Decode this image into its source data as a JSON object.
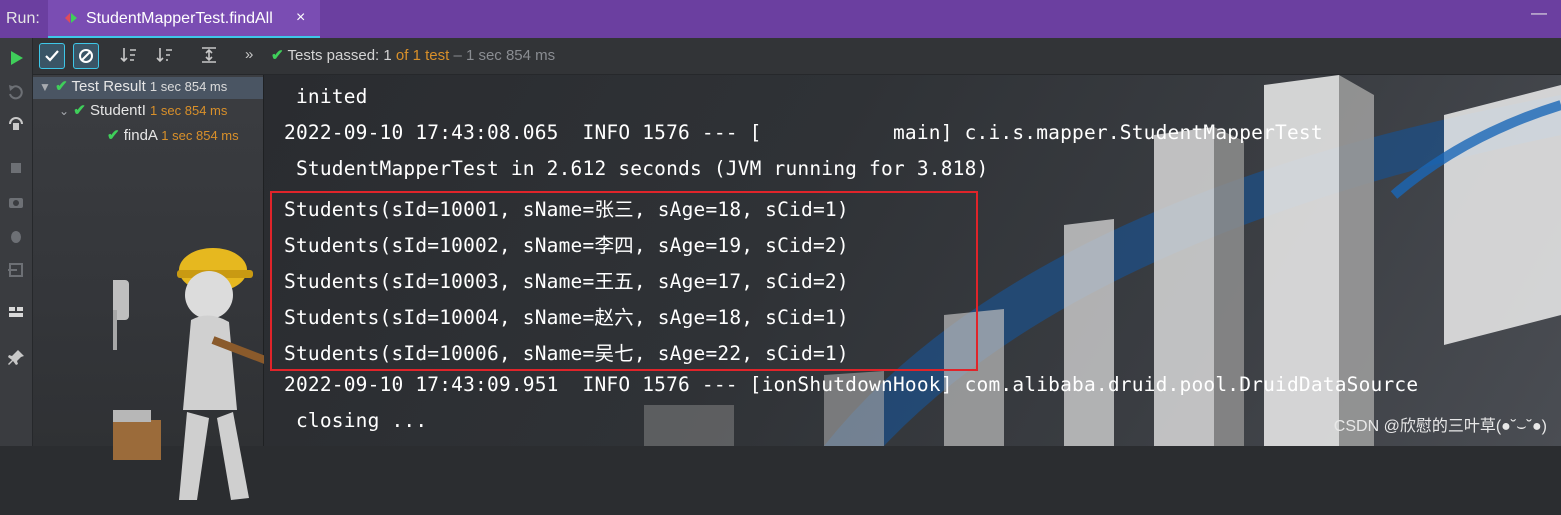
{
  "runbar": {
    "label": "Run:",
    "tab_title": "StudentMapperTest.findAll",
    "close": "×",
    "minimize": "—"
  },
  "toolbar": {
    "status_prefix": "Tests passed:",
    "passed_count": "1",
    "of_text": "of 1 test",
    "duration": "– 1 sec 854 ms",
    "overflow": "»"
  },
  "tree": {
    "items": [
      {
        "label": "Test Result",
        "time": "1 sec 854 ms"
      },
      {
        "label": "StudentI",
        "time": "1 sec 854 ms"
      },
      {
        "label": "findA",
        "time": "1 sec 854 ms"
      }
    ]
  },
  "console": {
    "lines": [
      " inited",
      "2022-09-10 17:43:08.065  INFO 1576 --- [           main] c.i.s.mapper.StudentMapperTest",
      " StudentMapperTest in 2.612 seconds (JVM running for 3.818)",
      "Students(sId=10001, sName=张三, sAge=18, sCid=1)",
      "Students(sId=10002, sName=李四, sAge=19, sCid=2)",
      "Students(sId=10003, sName=王五, sAge=17, sCid=2)",
      "Students(sId=10004, sName=赵六, sAge=18, sCid=1)",
      "Students(sId=10006, sName=吴七, sAge=22, sCid=1)",
      "2022-09-10 17:43:09.951  INFO 1576 --- [ionShutdownHook] com.alibaba.druid.pool.DruidDataSource",
      " closing ..."
    ],
    "watermark": "CSDN @欣慰的三叶草(●˘⌣˘●)"
  },
  "colors": {
    "accent": "#3ec7e8",
    "pass": "#3fcf5a",
    "time": "#d9902a",
    "highlight_box": "#e0242a",
    "tab_bar": "#6b3fa0"
  }
}
